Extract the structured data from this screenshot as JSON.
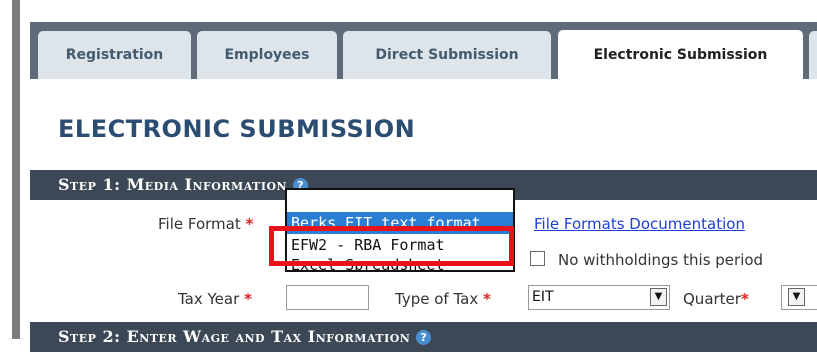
{
  "tabs": [
    {
      "label": "Registration",
      "active": false
    },
    {
      "label": "Employees",
      "active": false
    },
    {
      "label": "Direct Submission",
      "active": false
    },
    {
      "label": "Electronic Submission",
      "active": true
    }
  ],
  "page_title": "ELECTRONIC SUBMISSION",
  "step1": {
    "title": "Step 1: Media Information",
    "help": "?"
  },
  "step2": {
    "title": "Step 2: Enter Wage and Tax Information",
    "help": "?"
  },
  "form": {
    "file_format_label": "File Format",
    "required_mark": "*",
    "file_formats_link": "File Formats Documentation",
    "no_withholdings_label": "No withholdings this period",
    "tax_year_label": "Tax Year",
    "type_of_tax_label": "Type of Tax",
    "type_of_tax_value": "EIT",
    "quarter_label": "Quarter",
    "dropdown_arrow": "▼"
  },
  "file_format_options": [
    {
      "label": "Berks EIT text format",
      "selected": true
    },
    {
      "label": "EFW2 - RBA Format",
      "selected": false
    },
    {
      "label": "Excel Spreadsheet",
      "selected": false
    }
  ],
  "colors": {
    "highlight": "#e8121b",
    "selected_option": "#2a7fd4",
    "title": "#2c4d72",
    "step_bar": "#3d4856"
  }
}
